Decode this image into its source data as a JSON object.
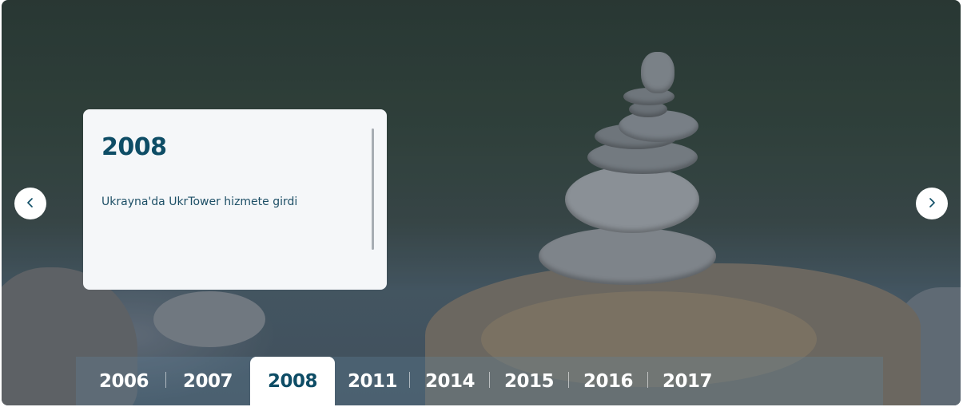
{
  "slide": {
    "year": "2008",
    "description": "Ukrayna'da UkrTower hizmete girdi"
  },
  "navigation": {
    "prev_icon": "chevron-left-icon",
    "next_icon": "chevron-right-icon"
  },
  "timeline": {
    "years": [
      "2006",
      "2007",
      "2008",
      "2011",
      "2014",
      "2015",
      "2016",
      "2017"
    ],
    "active_year": "2008"
  },
  "colors": {
    "accent": "#0e4d66",
    "card_background": "#f5f7f9",
    "year_bar_tint": "#5f829b"
  }
}
